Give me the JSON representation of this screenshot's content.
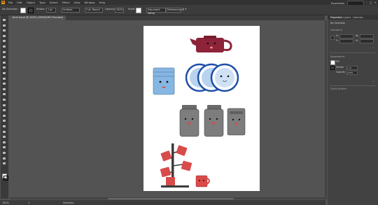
{
  "menubar": {
    "logo": "Ai",
    "menus": [
      "File",
      "Edit",
      "Object",
      "Type",
      "Select",
      "Effect",
      "View",
      "Window",
      "Help"
    ],
    "workspace": "Essentials",
    "window_controls": [
      "–",
      "□",
      "×"
    ]
  },
  "controlbar": {
    "selection_label": "No Selection",
    "stroke_label": "Stroke:",
    "stroke_value": "1 pt",
    "uniform_label": "Uniform",
    "brush_label": "5 pt. Round",
    "opacity_label": "Opacity:",
    "opacity_value": "100%",
    "style_label": "Style:",
    "document_setup": "Document Setup",
    "preferences": "Preferences",
    "colors": {
      "fill": "#ffffff",
      "stroke": "#000000"
    }
  },
  "document_tab": {
    "title": "final hw.ai @ 100% (CMYK/GPU Preview)"
  },
  "statusbar": {
    "zoom": "100%",
    "artboard_num": "1",
    "tool_name": "Selection"
  },
  "panel": {
    "tabs": [
      "Properties",
      "Layers",
      "Libraries"
    ],
    "no_selection": "No Selection",
    "transform_title": "Transform",
    "x_label": "X:",
    "y_label": "Y:",
    "w_label": "W:",
    "h_label": "H:",
    "appearance_title": "Appearance",
    "fill_label": "Fill",
    "stroke_label": "Stroke",
    "stroke_value": "1 pt",
    "opacity_label": "Opacity",
    "opacity_value": "100%",
    "quick_actions_title": "Quick Actions"
  },
  "tools": [
    "selection-tool",
    "direct-selection-tool",
    "magic-wand-tool",
    "lasso-tool",
    "pen-tool",
    "curvature-tool",
    "type-tool",
    "line-tool",
    "rectangle-tool",
    "paintbrush-tool",
    "pencil-tool",
    "eraser-tool",
    "rotate-tool",
    "scale-tool",
    "width-tool",
    "free-transform-tool",
    "shape-builder-tool",
    "perspective-tool",
    "mesh-tool",
    "gradient-tool",
    "eyedropper-tool",
    "blend-tool",
    "symbol-sprayer-tool",
    "graph-tool",
    "artboard-tool",
    "slice-tool",
    "hand-tool",
    "zoom-tool"
  ],
  "artwork_colors": {
    "teapot": "#8c2338",
    "blue_glass": "#86b7e3",
    "plate_blue": "#1f4fa8",
    "canister_gray": "#7d7d7d",
    "mug_red": "#d94a4a",
    "stand_dark": "#3c3c3c"
  }
}
